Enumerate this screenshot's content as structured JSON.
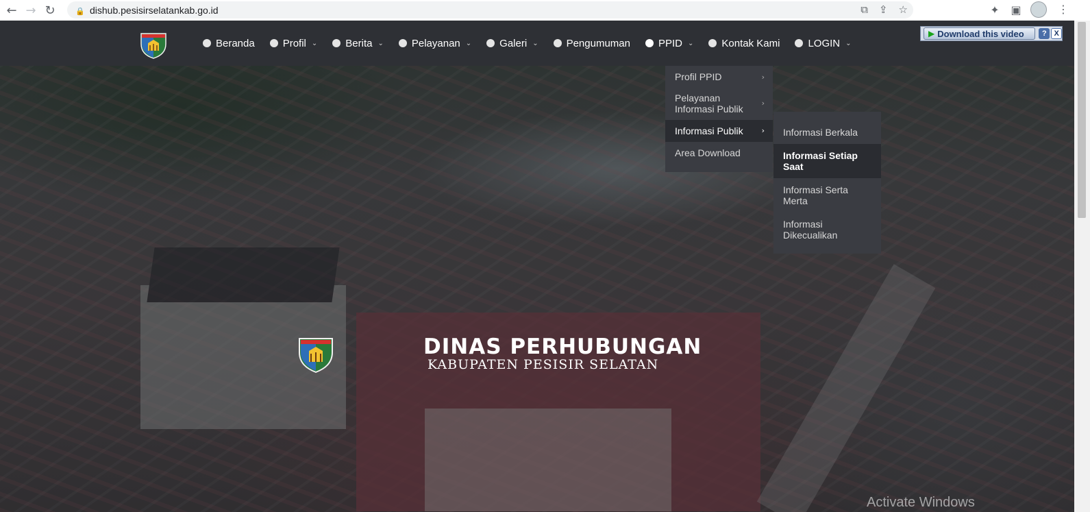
{
  "browser": {
    "url": "dishub.pesisirselatankab.go.id",
    "back_icon": "←",
    "forward_icon": "→",
    "reload_icon": "↻",
    "lock_icon": "🔒",
    "translate_icon": "⧉",
    "share_icon": "⇪",
    "star_icon": "☆",
    "extensions_icon": "✦",
    "sidepanel_icon": "▣",
    "menu_icon": "⋮"
  },
  "nav": {
    "items": [
      {
        "label": "Beranda",
        "has_dropdown": false
      },
      {
        "label": "Profil",
        "has_dropdown": true
      },
      {
        "label": "Berita",
        "has_dropdown": true
      },
      {
        "label": "Pelayanan",
        "has_dropdown": true
      },
      {
        "label": "Galeri",
        "has_dropdown": true
      },
      {
        "label": "Pengumuman",
        "has_dropdown": false
      },
      {
        "label": "PPID",
        "has_dropdown": true
      },
      {
        "label": "Kontak Kami",
        "has_dropdown": false
      },
      {
        "label": "LOGIN",
        "has_dropdown": true
      }
    ],
    "chevron": "⌄"
  },
  "ppid_menu": {
    "items": [
      {
        "label": "Profil PPID"
      },
      {
        "label": "Pelayanan Informasi Publik"
      },
      {
        "label": "Informasi Publik"
      },
      {
        "label": "Area Download"
      }
    ],
    "arrow": "›"
  },
  "informasi_publik_menu": {
    "items": [
      {
        "label": "Informasi Berkala"
      },
      {
        "label": "Informasi Setiap Saat"
      },
      {
        "label": "Informasi Serta Merta"
      },
      {
        "label": "Informasi Dikecualikan"
      }
    ]
  },
  "hero": {
    "title": "DINAS PERHUBUNGAN",
    "subtitle": "KABUPATEN PESISIR SELATAN"
  },
  "download_ext": {
    "label": "Download this video",
    "play_icon": "▶",
    "help": "?",
    "close": "X"
  },
  "watermark": "Activate Windows",
  "colors": {
    "navbar": "#2e3035",
    "dropdown": "#3a3c42",
    "dropdown_active": "#2a2c31"
  }
}
